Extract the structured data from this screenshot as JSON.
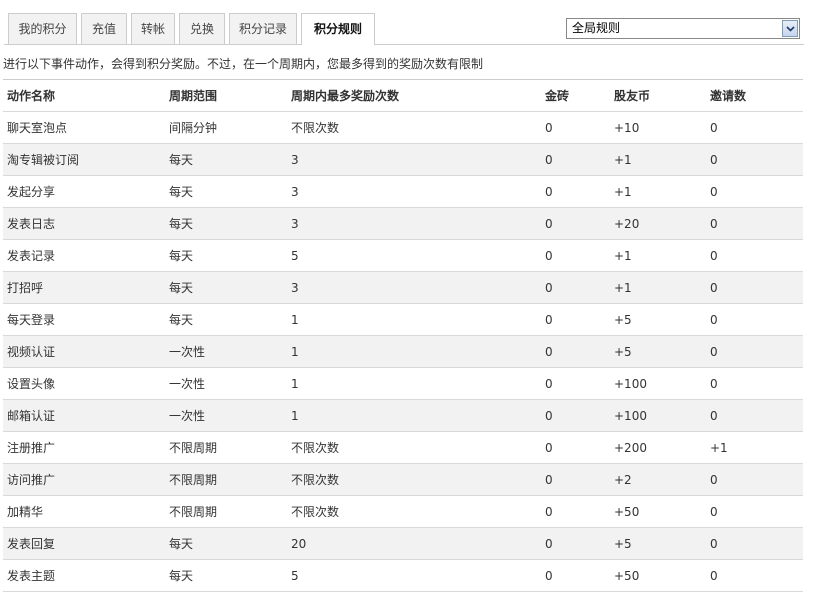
{
  "tabs": [
    {
      "label": "我的积分",
      "active": false
    },
    {
      "label": "充值",
      "active": false
    },
    {
      "label": "转帐",
      "active": false
    },
    {
      "label": "兑换",
      "active": false
    },
    {
      "label": "积分记录",
      "active": false
    },
    {
      "label": "积分规则",
      "active": true
    }
  ],
  "scope_select": {
    "selected": "全局规则"
  },
  "intro_text": "进行以下事件动作，会得到积分奖励。不过，在一个周期内，您最多得到的奖励次数有限制",
  "table": {
    "columns": [
      "动作名称",
      "周期范围",
      "周期内最多奖励次数",
      "金砖",
      "股友币",
      "邀请数"
    ],
    "rows": [
      [
        "聊天室泡点",
        "间隔分钟",
        "不限次数",
        "0",
        "+10",
        "0"
      ],
      [
        "淘专辑被订阅",
        "每天",
        "3",
        "0",
        "+1",
        "0"
      ],
      [
        "发起分享",
        "每天",
        "3",
        "0",
        "+1",
        "0"
      ],
      [
        "发表日志",
        "每天",
        "3",
        "0",
        "+20",
        "0"
      ],
      [
        "发表记录",
        "每天",
        "5",
        "0",
        "+1",
        "0"
      ],
      [
        "打招呼",
        "每天",
        "3",
        "0",
        "+1",
        "0"
      ],
      [
        "每天登录",
        "每天",
        "1",
        "0",
        "+5",
        "0"
      ],
      [
        "视频认证",
        "一次性",
        "1",
        "0",
        "+5",
        "0"
      ],
      [
        "设置头像",
        "一次性",
        "1",
        "0",
        "+100",
        "0"
      ],
      [
        "邮箱认证",
        "一次性",
        "1",
        "0",
        "+100",
        "0"
      ],
      [
        "注册推广",
        "不限周期",
        "不限次数",
        "0",
        "+200",
        "+1"
      ],
      [
        "访问推广",
        "不限周期",
        "不限次数",
        "0",
        "+2",
        "0"
      ],
      [
        "加精华",
        "不限周期",
        "不限次数",
        "0",
        "+50",
        "0"
      ],
      [
        "发表回复",
        "每天",
        "20",
        "0",
        "+5",
        "0"
      ],
      [
        "发表主题",
        "每天",
        "5",
        "0",
        "+50",
        "0"
      ]
    ]
  }
}
